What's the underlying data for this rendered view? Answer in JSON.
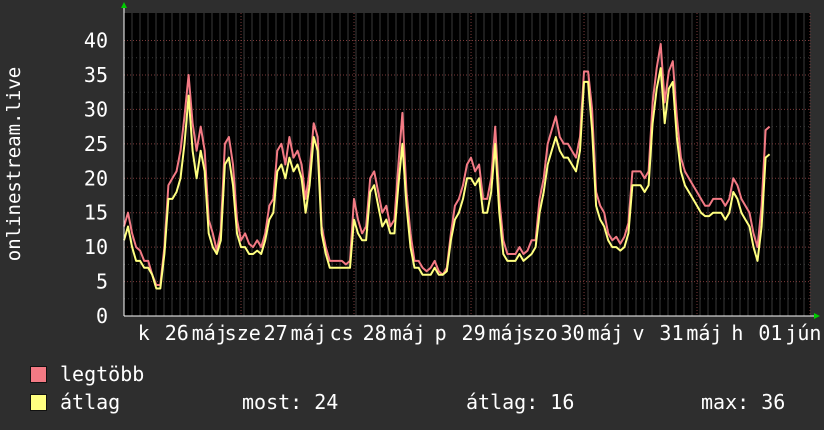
{
  "chart_data": {
    "type": "line",
    "ylabel": "onlinestream.live",
    "xlabel": "",
    "ylim": [
      0,
      44
    ],
    "yticks": [
      0,
      5,
      10,
      15,
      20,
      25,
      30,
      35,
      40
    ],
    "xtick_labels": [
      "k",
      "26",
      "máj",
      "sze",
      "27",
      "máj",
      "cs",
      "28",
      "máj",
      "p",
      "29",
      "máj",
      "szo",
      "30",
      "máj",
      "v",
      "31",
      "máj",
      "h",
      "01",
      "jún"
    ],
    "grid": true,
    "legend_placement": "bottom-left",
    "x_range": [
      0,
      170
    ],
    "series": [
      {
        "name": "legtöbb",
        "color": "#f37a84",
        "points": [
          [
            0,
            13
          ],
          [
            1,
            15
          ],
          [
            2,
            12
          ],
          [
            3,
            10
          ],
          [
            4,
            9.5
          ],
          [
            5,
            8
          ],
          [
            6,
            8
          ],
          [
            7,
            6
          ],
          [
            8,
            4.5
          ],
          [
            9,
            4.5
          ],
          [
            10,
            10
          ],
          [
            11,
            19
          ],
          [
            12,
            20
          ],
          [
            13,
            21
          ],
          [
            14,
            24
          ],
          [
            15,
            29
          ],
          [
            16,
            35
          ],
          [
            17,
            28
          ],
          [
            18,
            24
          ],
          [
            19,
            27.5
          ],
          [
            20,
            24
          ],
          [
            21,
            14
          ],
          [
            22,
            12
          ],
          [
            23,
            9.5
          ],
          [
            24,
            12.5
          ],
          [
            25,
            25
          ],
          [
            26,
            26
          ],
          [
            27,
            22
          ],
          [
            28,
            14
          ],
          [
            29,
            11
          ],
          [
            30,
            12
          ],
          [
            31,
            10.5
          ],
          [
            32,
            10
          ],
          [
            33,
            11
          ],
          [
            34,
            10
          ],
          [
            35,
            12
          ],
          [
            36,
            16
          ],
          [
            37,
            17
          ],
          [
            38,
            24
          ],
          [
            39,
            25
          ],
          [
            40,
            22
          ],
          [
            41,
            26
          ],
          [
            42,
            23
          ],
          [
            43,
            24
          ],
          [
            44,
            22
          ],
          [
            45,
            17
          ],
          [
            46,
            21
          ],
          [
            47,
            28
          ],
          [
            48,
            26
          ],
          [
            49,
            13
          ],
          [
            50,
            10
          ],
          [
            51,
            8
          ],
          [
            52,
            8
          ],
          [
            53,
            8
          ],
          [
            54,
            8
          ],
          [
            55,
            7.5
          ],
          [
            56,
            8
          ],
          [
            57,
            17
          ],
          [
            58,
            14
          ],
          [
            59,
            12
          ],
          [
            60,
            13
          ],
          [
            61,
            20
          ],
          [
            62,
            21
          ],
          [
            63,
            18
          ],
          [
            64,
            15
          ],
          [
            65,
            16
          ],
          [
            66,
            13
          ],
          [
            67,
            14
          ],
          [
            68,
            22
          ],
          [
            69,
            29.5
          ],
          [
            70,
            18
          ],
          [
            71,
            12
          ],
          [
            72,
            8
          ],
          [
            73,
            8
          ],
          [
            74,
            7
          ],
          [
            75,
            6.5
          ],
          [
            76,
            7
          ],
          [
            77,
            8
          ],
          [
            78,
            6.5
          ],
          [
            79,
            6
          ],
          [
            80,
            7
          ],
          [
            81,
            12
          ],
          [
            82,
            16
          ],
          [
            83,
            17
          ],
          [
            84,
            19
          ],
          [
            85,
            22
          ],
          [
            86,
            23
          ],
          [
            87,
            21
          ],
          [
            88,
            22
          ],
          [
            89,
            17
          ],
          [
            90,
            17
          ],
          [
            91,
            20
          ],
          [
            92,
            27.5
          ],
          [
            93,
            17
          ],
          [
            94,
            11
          ],
          [
            95,
            9
          ],
          [
            96,
            9
          ],
          [
            97,
            9
          ],
          [
            98,
            10
          ],
          [
            99,
            9
          ],
          [
            100,
            9.5
          ],
          [
            101,
            11
          ],
          [
            102,
            11
          ],
          [
            103,
            17
          ],
          [
            104,
            20
          ],
          [
            105,
            25
          ],
          [
            106,
            27
          ],
          [
            107,
            29
          ],
          [
            108,
            26
          ],
          [
            109,
            25
          ],
          [
            110,
            25
          ],
          [
            111,
            24
          ],
          [
            112,
            23
          ],
          [
            113,
            26
          ],
          [
            114,
            35.5
          ],
          [
            115,
            35.5
          ],
          [
            116,
            30
          ],
          [
            117,
            18
          ],
          [
            118,
            16
          ],
          [
            119,
            15
          ],
          [
            120,
            12
          ],
          [
            121,
            11
          ],
          [
            122,
            11.5
          ],
          [
            123,
            10.5
          ],
          [
            124,
            11.5
          ],
          [
            125,
            13.5
          ],
          [
            126,
            21
          ],
          [
            127,
            21
          ],
          [
            128,
            21
          ],
          [
            129,
            20
          ],
          [
            130,
            21
          ],
          [
            131,
            31
          ],
          [
            132,
            36
          ],
          [
            133,
            39.5
          ],
          [
            134,
            31
          ],
          [
            135,
            35.5
          ],
          [
            136,
            37
          ],
          [
            137,
            29
          ],
          [
            138,
            23
          ],
          [
            139,
            21
          ],
          [
            140,
            20
          ],
          [
            141,
            19
          ],
          [
            142,
            18
          ],
          [
            143,
            17
          ],
          [
            144,
            16
          ],
          [
            145,
            16
          ],
          [
            146,
            17
          ],
          [
            147,
            17
          ],
          [
            148,
            17
          ],
          [
            149,
            16
          ],
          [
            150,
            17
          ],
          [
            151,
            20
          ],
          [
            152,
            19
          ],
          [
            153,
            17
          ],
          [
            154,
            16
          ],
          [
            155,
            15
          ],
          [
            156,
            12
          ],
          [
            157,
            10
          ],
          [
            158,
            16
          ],
          [
            159,
            27
          ],
          [
            160,
            27.5
          ]
        ]
      },
      {
        "name": "átlag",
        "color": "#ffff80",
        "points": [
          [
            0,
            11
          ],
          [
            1,
            13
          ],
          [
            2,
            10
          ],
          [
            3,
            8
          ],
          [
            4,
            8
          ],
          [
            5,
            7
          ],
          [
            6,
            7
          ],
          [
            7,
            6
          ],
          [
            8,
            4
          ],
          [
            9,
            4
          ],
          [
            10,
            9
          ],
          [
            11,
            17
          ],
          [
            12,
            17
          ],
          [
            13,
            18
          ],
          [
            14,
            20
          ],
          [
            15,
            25
          ],
          [
            16,
            32
          ],
          [
            17,
            24
          ],
          [
            18,
            20
          ],
          [
            19,
            24
          ],
          [
            20,
            21
          ],
          [
            21,
            12
          ],
          [
            22,
            10
          ],
          [
            23,
            9
          ],
          [
            24,
            11
          ],
          [
            25,
            22
          ],
          [
            26,
            23
          ],
          [
            27,
            19
          ],
          [
            28,
            12
          ],
          [
            29,
            10
          ],
          [
            30,
            10
          ],
          [
            31,
            9
          ],
          [
            32,
            9
          ],
          [
            33,
            9.5
          ],
          [
            34,
            9
          ],
          [
            35,
            11
          ],
          [
            36,
            14
          ],
          [
            37,
            15
          ],
          [
            38,
            21
          ],
          [
            39,
            22
          ],
          [
            40,
            20
          ],
          [
            41,
            23
          ],
          [
            42,
            21
          ],
          [
            43,
            22
          ],
          [
            44,
            20
          ],
          [
            45,
            15
          ],
          [
            46,
            19
          ],
          [
            47,
            26
          ],
          [
            48,
            24
          ],
          [
            49,
            12
          ],
          [
            50,
            9
          ],
          [
            51,
            7
          ],
          [
            52,
            7
          ],
          [
            53,
            7
          ],
          [
            54,
            7
          ],
          [
            55,
            7
          ],
          [
            56,
            7
          ],
          [
            57,
            14
          ],
          [
            58,
            12
          ],
          [
            59,
            11
          ],
          [
            60,
            11
          ],
          [
            61,
            18
          ],
          [
            62,
            19
          ],
          [
            63,
            16
          ],
          [
            64,
            13
          ],
          [
            65,
            14
          ],
          [
            66,
            12
          ],
          [
            67,
            12
          ],
          [
            68,
            19
          ],
          [
            69,
            25
          ],
          [
            70,
            16
          ],
          [
            71,
            10
          ],
          [
            72,
            7
          ],
          [
            73,
            7
          ],
          [
            74,
            6
          ],
          [
            75,
            6
          ],
          [
            76,
            6
          ],
          [
            77,
            7
          ],
          [
            78,
            6
          ],
          [
            79,
            6
          ],
          [
            80,
            6.5
          ],
          [
            81,
            11
          ],
          [
            82,
            14
          ],
          [
            83,
            15
          ],
          [
            84,
            17
          ],
          [
            85,
            20
          ],
          [
            86,
            20
          ],
          [
            87,
            19
          ],
          [
            88,
            20
          ],
          [
            89,
            15
          ],
          [
            90,
            15
          ],
          [
            91,
            18
          ],
          [
            92,
            25
          ],
          [
            93,
            15
          ],
          [
            94,
            9
          ],
          [
            95,
            8
          ],
          [
            96,
            8
          ],
          [
            97,
            8
          ],
          [
            98,
            9
          ],
          [
            99,
            8
          ],
          [
            100,
            8.5
          ],
          [
            101,
            9
          ],
          [
            102,
            10
          ],
          [
            103,
            15
          ],
          [
            104,
            18
          ],
          [
            105,
            22
          ],
          [
            106,
            24
          ],
          [
            107,
            26
          ],
          [
            108,
            24
          ],
          [
            109,
            23
          ],
          [
            110,
            23
          ],
          [
            111,
            22
          ],
          [
            112,
            21
          ],
          [
            113,
            24
          ],
          [
            114,
            34
          ],
          [
            115,
            34
          ],
          [
            116,
            27
          ],
          [
            117,
            16
          ],
          [
            118,
            14
          ],
          [
            119,
            13
          ],
          [
            120,
            11
          ],
          [
            121,
            10
          ],
          [
            122,
            10
          ],
          [
            123,
            9.5
          ],
          [
            124,
            10
          ],
          [
            125,
            12
          ],
          [
            126,
            19
          ],
          [
            127,
            19
          ],
          [
            128,
            19
          ],
          [
            129,
            18
          ],
          [
            130,
            19
          ],
          [
            131,
            28
          ],
          [
            132,
            33
          ],
          [
            133,
            36
          ],
          [
            134,
            28
          ],
          [
            135,
            33
          ],
          [
            136,
            34
          ],
          [
            137,
            26
          ],
          [
            138,
            21
          ],
          [
            139,
            19
          ],
          [
            140,
            18
          ],
          [
            141,
            17
          ],
          [
            142,
            16
          ],
          [
            143,
            15
          ],
          [
            144,
            14.5
          ],
          [
            145,
            14.5
          ],
          [
            146,
            15
          ],
          [
            147,
            15
          ],
          [
            148,
            15
          ],
          [
            149,
            14
          ],
          [
            150,
            15
          ],
          [
            151,
            18
          ],
          [
            152,
            17
          ],
          [
            153,
            15
          ],
          [
            154,
            14
          ],
          [
            155,
            13
          ],
          [
            156,
            10
          ],
          [
            157,
            8
          ],
          [
            158,
            13
          ],
          [
            159,
            23
          ],
          [
            160,
            23.5
          ]
        ]
      }
    ]
  },
  "legend": [
    {
      "label": "legtöbb",
      "color": "#f37a84"
    },
    {
      "label": "átlag",
      "color": "#ffff80"
    }
  ],
  "stats": {
    "now": "most: 24",
    "avg": "átlag: 16",
    "max": "max: 36"
  }
}
